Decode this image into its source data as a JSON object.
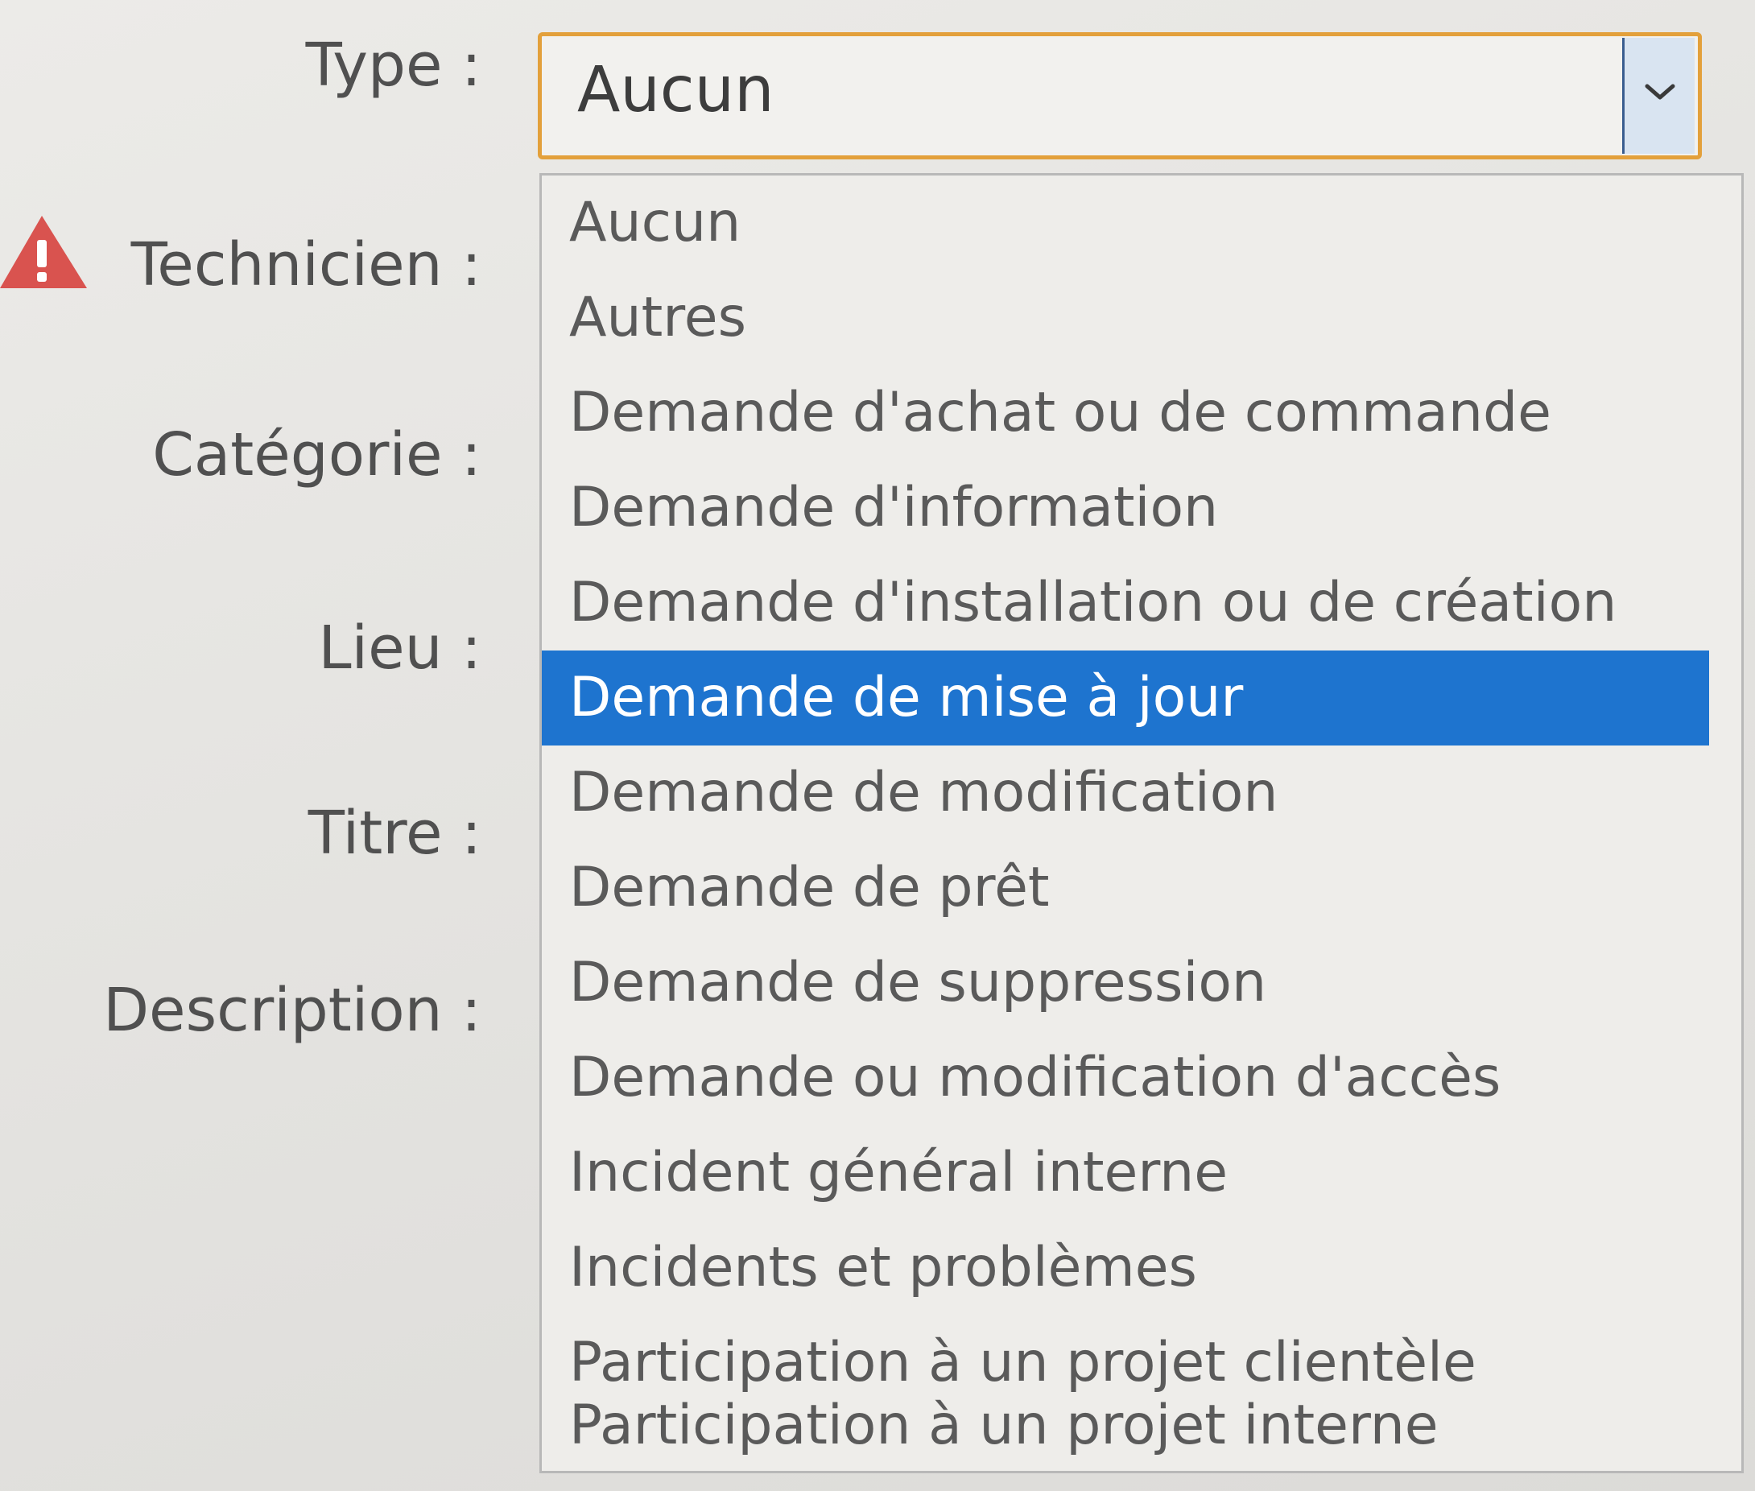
{
  "form": {
    "labels": {
      "type": "Type :",
      "technicien": "Technicien :",
      "categorie": "Catégorie :",
      "lieu": "Lieu :",
      "titre": "Titre :",
      "description": "Description :"
    },
    "type_select": {
      "value": "Aucun"
    },
    "warning_icon": "warning-triangle-icon",
    "arrow_icon": "chevron-down-icon"
  },
  "dropdown": {
    "options": [
      "Aucun",
      "Autres",
      "Demande d'achat ou de commande",
      "Demande d'information",
      "Demande d'installation ou de création",
      "Demande de mise à jour",
      "Demande de modification",
      "Demande de prêt",
      "Demande de suppression",
      "Demande ou modification d'accès",
      "Incident général interne",
      "Incidents et problèmes",
      "Participation à un projet clientèle",
      "Participation à un projet interne"
    ],
    "highlighted": "Demande de mise à jour"
  },
  "colors": {
    "focus_border": "#e3a03b",
    "highlight": "#1e74cf",
    "warning": "#d9534f"
  }
}
